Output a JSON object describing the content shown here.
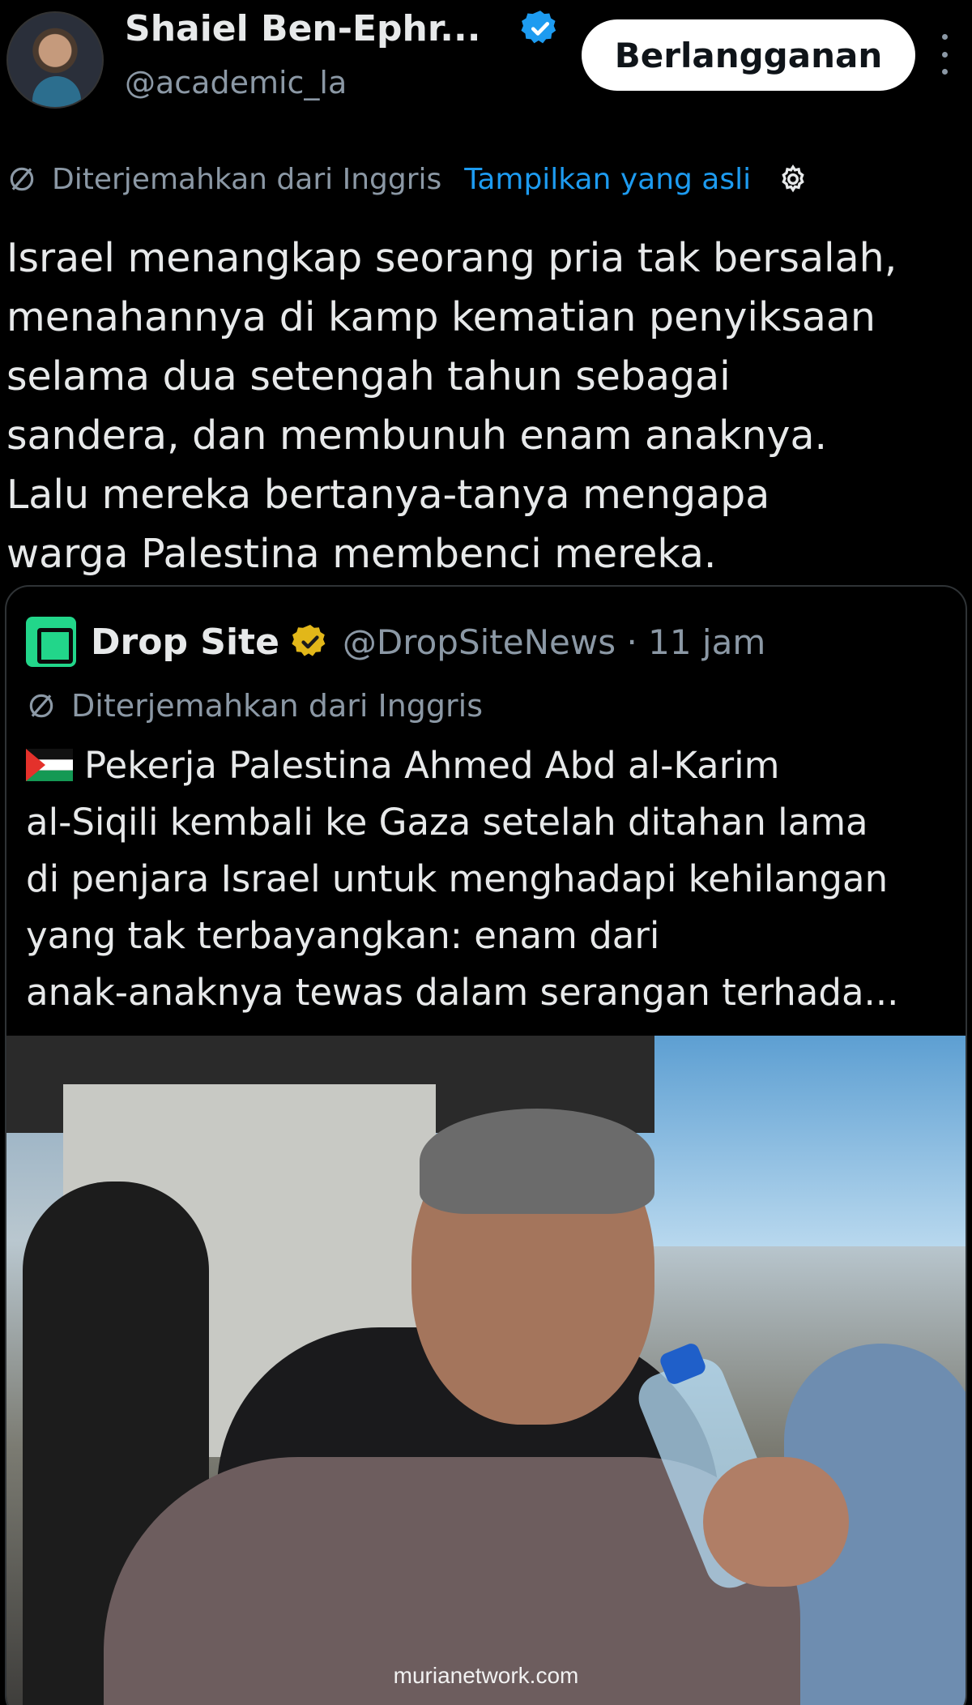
{
  "header": {
    "display_name": "Shaiel Ben-Ephr...",
    "handle": "@academic_la",
    "subscribe_label": "Berlangganan"
  },
  "translation": {
    "label": "Diterjemahkan dari Inggris",
    "show_original": "Tampilkan yang asli"
  },
  "tweet": {
    "lines": [
      "Israel menangkap seorang pria tak bersalah,",
      "menahannya di kamp kematian penyiksaan",
      "selama dua setengah tahun sebagai",
      "sandera, dan membunuh enam anaknya.",
      "Lalu mereka bertanya-tanya mengapa",
      "warga Palestina membenci mereka."
    ]
  },
  "quote": {
    "name": "Drop Site",
    "handle_time": "@DropSiteNews · 11 jam",
    "translation_label": "Diterjemahkan dari Inggris",
    "lines": [
      "Pekerja Palestina Ahmed Abd al-Karim",
      "al-Siqili kembali ke Gaza setelah ditahan lama",
      "di penjara Israel untuk menghadapi kehilangan",
      "yang tak terbayangkan: enam dari",
      "anak-anaknya tewas dalam serangan terhada..."
    ]
  },
  "watermark": "murianetwork.com",
  "colors": {
    "background": "#000000",
    "link_blue": "#1d9bf0",
    "verified_blue": "#1d9bf0",
    "verified_gold": "#e2b719",
    "muted_text": "#8b98a5"
  },
  "icons": [
    "verified-badge-icon",
    "translate-icon",
    "gear-icon",
    "more-options-icon",
    "gold-check-icon",
    "palestine-flag-icon"
  ]
}
